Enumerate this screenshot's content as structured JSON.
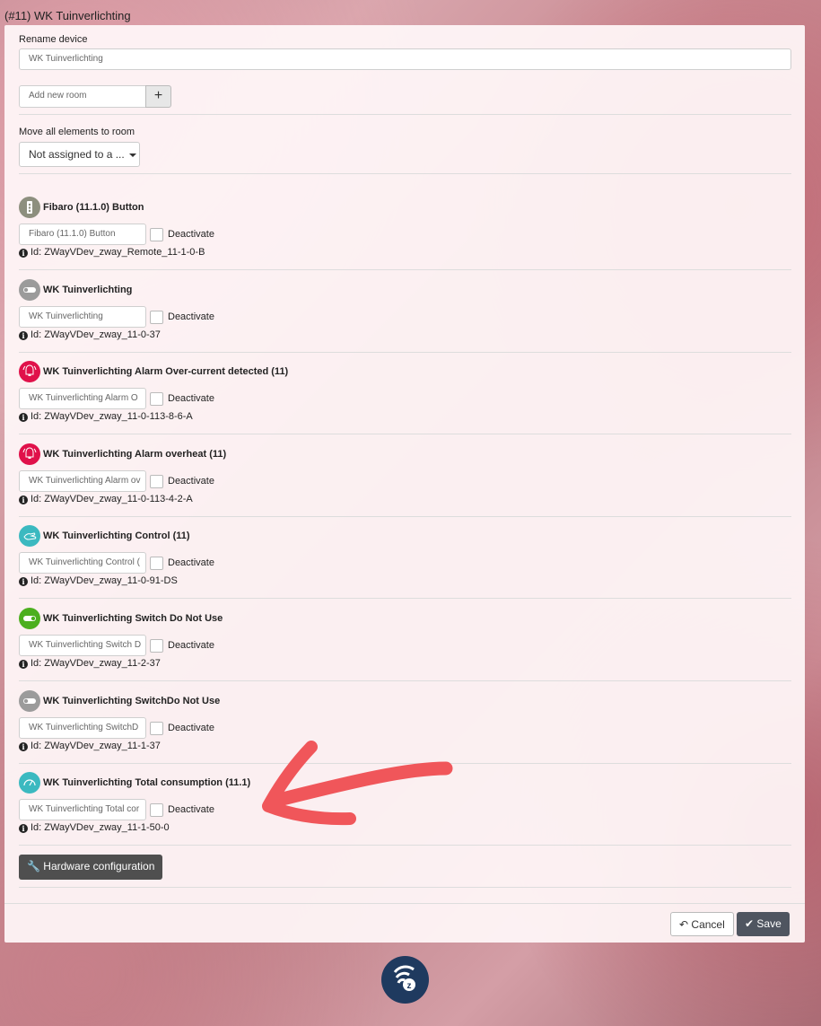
{
  "window": {
    "title": "(#11) WK Tuinverlichting"
  },
  "rename": {
    "label": "Rename device",
    "value": "WK Tuinverlichting"
  },
  "room": {
    "placeholder": "Add new room",
    "add_label": "+"
  },
  "move": {
    "label": "Move all elements to room",
    "selected": "Not assigned to a ..."
  },
  "devices": [
    {
      "title": "Fibaro (11.1.0) Button",
      "input": "Fibaro (11.1.0) Button",
      "deactivate": "Deactivate",
      "id": "Id: ZWayVDev_zway_Remote_11-1-0-B",
      "icon": "remote-button-icon",
      "color": "#8d8f7e"
    },
    {
      "title": "WK Tuinverlichting",
      "input": "WK Tuinverlichting",
      "deactivate": "Deactivate",
      "id": "Id: ZWayVDev_zway_11-0-37",
      "icon": "switch-off-icon",
      "color": "#9b9b9b"
    },
    {
      "title": "WK Tuinverlichting Alarm Over-current detected (11)",
      "input": "WK Tuinverlichting Alarm O",
      "deactivate": "Deactivate",
      "id": "Id: ZWayVDev_zway_11-0-113-8-6-A",
      "icon": "alarm-icon",
      "color": "#e0114a"
    },
    {
      "title": "WK Tuinverlichting Alarm overheat (11)",
      "input": "WK Tuinverlichting Alarm ov",
      "deactivate": "Deactivate",
      "id": "Id: ZWayVDev_zway_11-0-113-4-2-A",
      "icon": "alarm-icon",
      "color": "#e0114a"
    },
    {
      "title": "WK Tuinverlichting Control (11)",
      "input": "WK Tuinverlichting Control (",
      "deactivate": "Deactivate",
      "id": "Id: ZWayVDev_zway_11-0-91-DS",
      "icon": "control-hand-icon",
      "color": "#3bb9c0"
    },
    {
      "title": "WK Tuinverlichting Switch Do Not Use",
      "input": "WK Tuinverlichting Switch D",
      "deactivate": "Deactivate",
      "id": "Id: ZWayVDev_zway_11-2-37",
      "icon": "switch-on-icon",
      "color": "#4caf1f"
    },
    {
      "title": "WK Tuinverlichting SwitchDo Not Use",
      "input": "WK Tuinverlichting SwitchD",
      "deactivate": "Deactivate",
      "id": "Id: ZWayVDev_zway_11-1-37",
      "icon": "switch-off-icon",
      "color": "#9b9b9b"
    },
    {
      "title": "WK Tuinverlichting Total consumption (11.1)",
      "input": "WK Tuinverlichting Total cor",
      "deactivate": "Deactivate",
      "id": "Id: ZWayVDev_zway_11-1-50-0",
      "icon": "meter-icon",
      "color": "#3bb9c0"
    }
  ],
  "hardware": {
    "label": "Hardware configuration",
    "icon": "wrench-icon"
  },
  "footer": {
    "cancel_label": "Cancel",
    "save_label": "Save",
    "cancel_icon": "undo-icon",
    "save_icon": "check-icon"
  },
  "annotation": {
    "color": "#f0565a"
  },
  "logo": {
    "icon": "zway-logo-icon"
  }
}
